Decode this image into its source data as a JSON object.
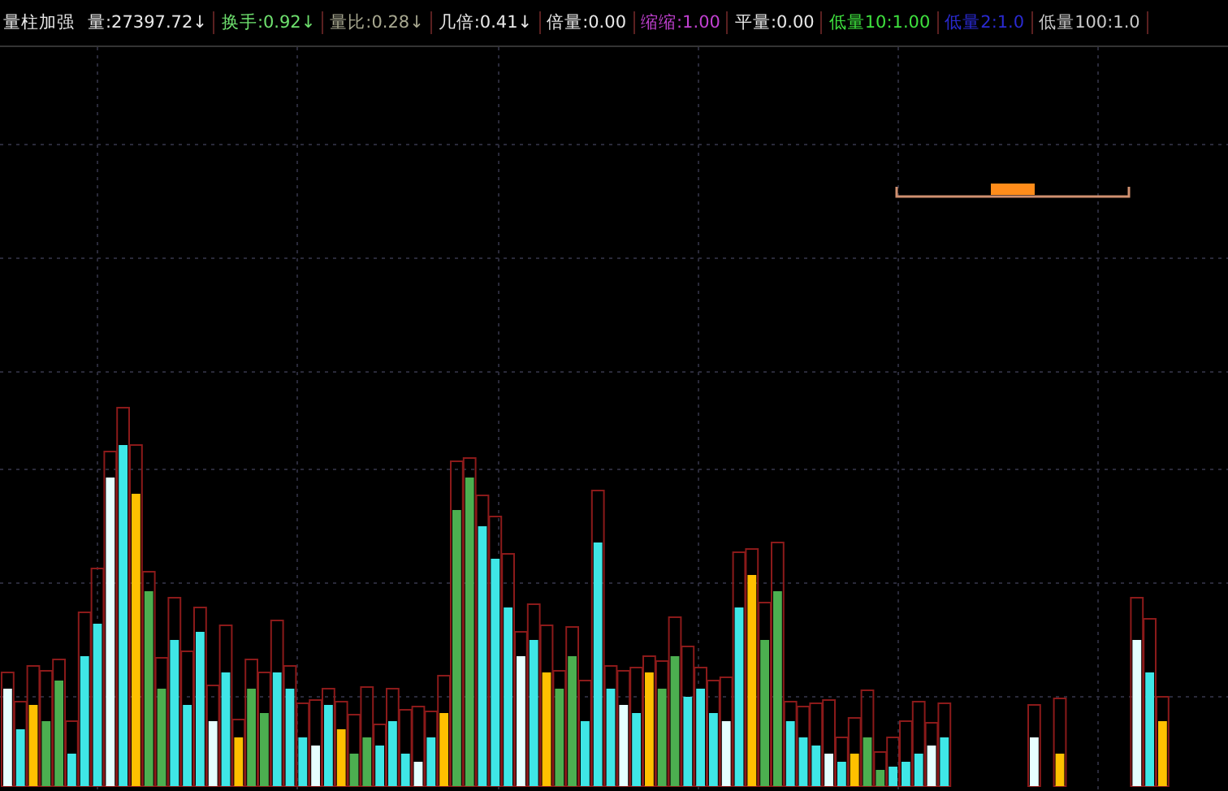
{
  "indicator": {
    "title": "量柱加强"
  },
  "readings": [
    {
      "text": "量:27397.72↓",
      "color": "#e8e8e8"
    },
    {
      "text": "换手:0.92↓",
      "color": "#6ee06e"
    },
    {
      "text": "量比:0.28↓",
      "color": "#a8a890"
    },
    {
      "text": "几倍:0.41↓",
      "color": "#e8e8e8"
    },
    {
      "text": "倍量:0.00",
      "color": "#e8e8e8"
    },
    {
      "text": "缩缩:1.00",
      "color": "#c040d0"
    },
    {
      "text": "平量:0.00",
      "color": "#e8e8e8"
    },
    {
      "text": "低量10:1.00",
      "color": "#3ee03e"
    },
    {
      "text": "低量2:1.0",
      "color": "#2a2ad0"
    },
    {
      "text": "低量100:1.0",
      "color": "#c8c8c8"
    }
  ]
}
